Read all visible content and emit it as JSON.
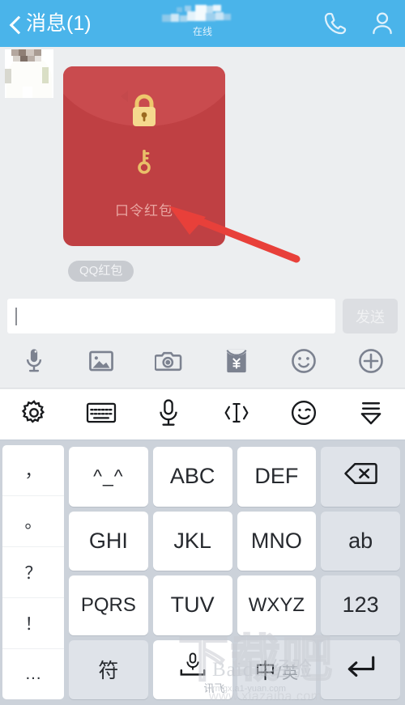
{
  "header": {
    "back_label": "消息(1)",
    "back_icon": "chevron-left-icon",
    "contact_name_masked": "",
    "status": "在线",
    "call_icon": "phone-icon",
    "profile_icon": "person-icon",
    "bg_color": "#4ab4ea"
  },
  "chat": {
    "background": "#eceef0",
    "avatar_name": "contact-avatar",
    "message": {
      "type": "red-packet",
      "title": "口令红包",
      "badge": "QQ红包",
      "lock_icon": "lock-icon",
      "key_icon": "key-icon",
      "packet_color": "#bf4043",
      "flap_color": "#c94b4e",
      "gold_color": "#efc86a"
    },
    "annotation": {
      "type": "arrow",
      "color": "#e8403a",
      "points_to": "key-icon"
    }
  },
  "input": {
    "value": "",
    "placeholder": "",
    "send_label": "发送",
    "send_enabled": false
  },
  "chat_toolbar": {
    "items": [
      {
        "icon": "microphone-icon",
        "label": "语音"
      },
      {
        "icon": "image-icon",
        "label": "图片"
      },
      {
        "icon": "camera-icon",
        "label": "拍照"
      },
      {
        "icon": "red-packet-icon",
        "label": "红包"
      },
      {
        "icon": "emoji-icon",
        "label": "表情"
      },
      {
        "icon": "plus-circle-icon",
        "label": "更多"
      }
    ]
  },
  "ime_toolbar": {
    "items": [
      {
        "icon": "gear-icon",
        "label": "设置"
      },
      {
        "icon": "keyboard-icon",
        "label": "键盘"
      },
      {
        "icon": "microphone-icon",
        "label": "语音输入"
      },
      {
        "icon": "cursor-move-icon",
        "label": "光标移动"
      },
      {
        "icon": "emoji-wink-icon",
        "label": "表情"
      },
      {
        "icon": "collapse-keyboard-icon",
        "label": "收起键盘"
      }
    ]
  },
  "keyboard": {
    "punctuation": [
      "，",
      "。",
      "？",
      "！",
      "…"
    ],
    "keys": [
      {
        "label": "^_^",
        "name": "key-emoticon",
        "style": "emoji"
      },
      {
        "label": "ABC",
        "name": "key-abc",
        "style": "normal"
      },
      {
        "label": "DEF",
        "name": "key-def",
        "style": "normal"
      },
      {
        "label": "⌫",
        "name": "key-backspace",
        "style": "fn-icon"
      },
      {
        "label": "GHI",
        "name": "key-ghi",
        "style": "normal"
      },
      {
        "label": "JKL",
        "name": "key-jkl",
        "style": "normal"
      },
      {
        "label": "MNO",
        "name": "key-mno",
        "style": "normal"
      },
      {
        "label": "ab",
        "name": "key-ab",
        "style": "fn"
      },
      {
        "label": "PQRS",
        "name": "key-pqrs",
        "style": "small"
      },
      {
        "label": "TUV",
        "name": "key-tuv",
        "style": "normal"
      },
      {
        "label": "WXYZ",
        "name": "key-wxyz",
        "style": "small"
      },
      {
        "label": "123",
        "name": "key-123",
        "style": "fn"
      },
      {
        "label": "符",
        "name": "key-symbol",
        "style": "fn-cn"
      },
      {
        "label": "",
        "name": "key-space",
        "style": "space"
      },
      {
        "label": "",
        "name": "key-lang",
        "style": "lang"
      },
      {
        "label": "↵",
        "name": "key-enter",
        "style": "fn-icon"
      }
    ],
    "space_sub_label": "讯飞",
    "lang_cn": "中",
    "lang_sep": "/",
    "lang_en": "英"
  },
  "watermark": {
    "big": "下载吧",
    "mid": "Baidu 经验",
    "small": "rmgx.a1-yuan.com",
    "url": "www.xiazaiba.com"
  }
}
